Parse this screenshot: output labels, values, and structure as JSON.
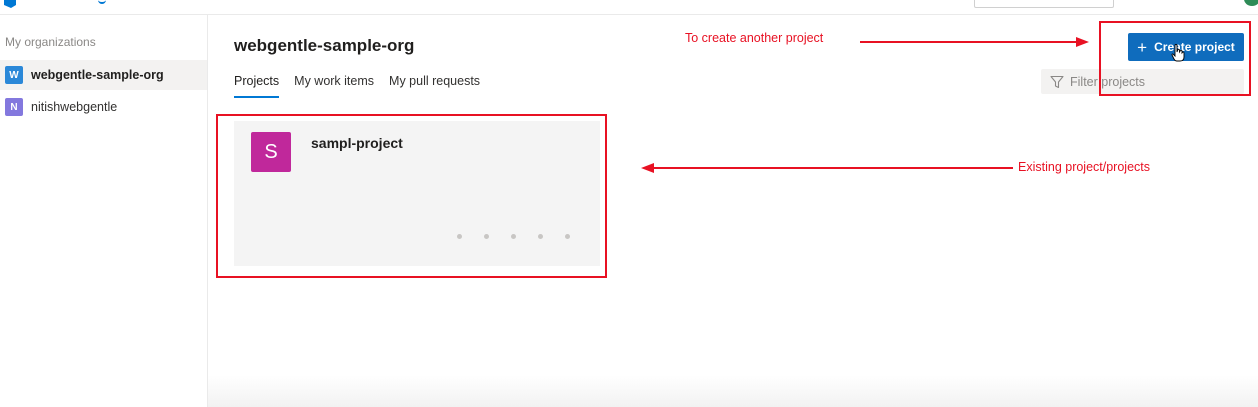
{
  "sidebar": {
    "title": "My organizations",
    "orgs": [
      {
        "initial": "W",
        "name": "webgentle-sample-org",
        "color": "#2b88d8",
        "active": true
      },
      {
        "initial": "N",
        "name": "nitishwebgentle",
        "color": "#8378de",
        "active": false
      }
    ]
  },
  "main": {
    "org_title": "webgentle-sample-org",
    "tabs": [
      {
        "label": "Projects",
        "active": true
      },
      {
        "label": "My work items",
        "active": false
      },
      {
        "label": "My pull requests",
        "active": false
      }
    ],
    "filter": {
      "placeholder": "Filter projects",
      "icon": "filter-icon"
    },
    "create_button": {
      "label": "Create project",
      "icon": "plus-icon"
    },
    "projects": [
      {
        "initial": "S",
        "name": "sampl-project",
        "color": "#c0289b"
      }
    ]
  },
  "annotations": {
    "create_note": "To create another project",
    "existing_note": "Existing project/projects",
    "color": "#e81123"
  }
}
